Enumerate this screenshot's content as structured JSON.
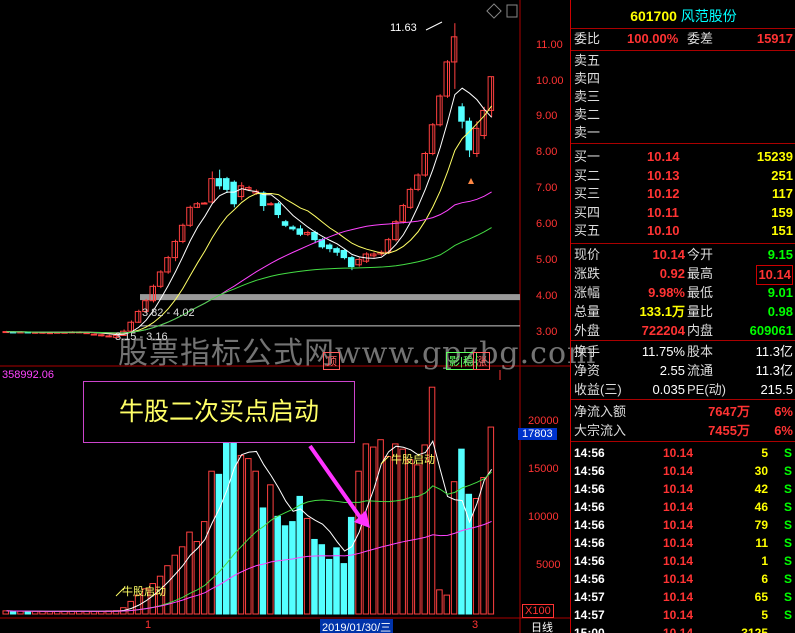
{
  "stock": {
    "code": "601700",
    "name": "风范股份"
  },
  "quote": {
    "wei_bi_label": "委比",
    "wei_bi": "100.00%",
    "wei_cha_label": "委差",
    "wei_cha": "15917",
    "sells": [
      {
        "label": "卖五",
        "price": "",
        "vol": ""
      },
      {
        "label": "卖四",
        "price": "",
        "vol": ""
      },
      {
        "label": "卖三",
        "price": "",
        "vol": ""
      },
      {
        "label": "卖二",
        "price": "",
        "vol": ""
      },
      {
        "label": "卖一",
        "price": "",
        "vol": ""
      }
    ],
    "buys": [
      {
        "label": "买一",
        "price": "10.14",
        "vol": "15239"
      },
      {
        "label": "买二",
        "price": "10.13",
        "vol": "251"
      },
      {
        "label": "买三",
        "price": "10.12",
        "vol": "117"
      },
      {
        "label": "买四",
        "price": "10.11",
        "vol": "159"
      },
      {
        "label": "买五",
        "price": "10.10",
        "vol": "151"
      }
    ],
    "stats": [
      {
        "l1": "现价",
        "v1": "10.14",
        "c1": "red",
        "l2": "今开",
        "v2": "9.15",
        "c2": "grn"
      },
      {
        "l1": "涨跌",
        "v1": "0.92",
        "c1": "red",
        "l2": "最高",
        "v2": "10.14",
        "c2": "red"
      },
      {
        "l1": "涨幅",
        "v1": "9.98%",
        "c1": "red",
        "l2": "最低",
        "v2": "9.01",
        "c2": "grn"
      },
      {
        "l1": "总量",
        "v1": "133.1万",
        "c1": "yel",
        "l2": "量比",
        "v2": "0.98",
        "c2": "grn"
      },
      {
        "l1": "外盘",
        "v1": "722204",
        "c1": "red",
        "l2": "内盘",
        "v2": "609061",
        "c2": "grn"
      }
    ],
    "stats2": [
      {
        "l1": "换手",
        "v1": "11.75%",
        "l2": "股本",
        "v2": "11.3亿"
      },
      {
        "l1": "净资",
        "v1": "2.55",
        "l2": "流通",
        "v2": "11.3亿"
      },
      {
        "l1": "收益(三)",
        "v1": "0.035",
        "l2": "PE(动)",
        "v2": "215.5"
      }
    ],
    "flows": [
      {
        "label": "净流入额",
        "value": "7647万",
        "pct": "6%"
      },
      {
        "label": "大宗流入",
        "value": "7455万",
        "pct": "6%"
      }
    ]
  },
  "ticks": [
    {
      "time": "14:56",
      "price": "10.14",
      "vol": "5",
      "side": "S"
    },
    {
      "time": "14:56",
      "price": "10.14",
      "vol": "30",
      "side": "S"
    },
    {
      "time": "14:56",
      "price": "10.14",
      "vol": "42",
      "side": "S"
    },
    {
      "time": "14:56",
      "price": "10.14",
      "vol": "46",
      "side": "S"
    },
    {
      "time": "14:56",
      "price": "10.14",
      "vol": "79",
      "side": "S"
    },
    {
      "time": "14:56",
      "price": "10.14",
      "vol": "11",
      "side": "S"
    },
    {
      "time": "14:56",
      "price": "10.14",
      "vol": "1",
      "side": "S"
    },
    {
      "time": "14:56",
      "price": "10.14",
      "vol": "6",
      "side": "S"
    },
    {
      "time": "14:57",
      "price": "10.14",
      "vol": "65",
      "side": "S"
    },
    {
      "time": "14:57",
      "price": "10.14",
      "vol": "5",
      "side": "S"
    },
    {
      "time": "15:00",
      "price": "10.14",
      "vol": "3125",
      "side": ""
    }
  ],
  "chart": {
    "price_axis": [
      "11.00",
      "10.00",
      "9.00",
      "8.00",
      "7.00",
      "6.00",
      "5.00",
      "4.00",
      "3.00"
    ],
    "vol_axis": [
      "20000",
      "15000",
      "10000",
      "5000"
    ],
    "peak_label": "11.63",
    "range_label_1": "3.82 - 4.02",
    "range_label_2": "3.15 - 3.16",
    "vol_top_value": "358992.06",
    "vol_cursor_value": "17803",
    "vol_unit": "X100",
    "date_label": "2019/01/30/三",
    "x_tick_1": "1",
    "x_tick_2": "3",
    "bottom_tab": "日线",
    "tag_ding": "顶",
    "tag_ying": "影|稳",
    "tag_zhang": "涨",
    "annotation": "牛股二次买点启动",
    "arrow_label_1": "牛股启动",
    "arrow_label_2": "牛股启动",
    "watermark": "股票指标公式网www.gpzbg.com"
  },
  "colors": {
    "up": "#ff4040",
    "down": "#54ffff",
    "ma1": "#ffffff",
    "ma2": "#ffff66",
    "ma3": "#ff44ff",
    "ma4": "#44dd44"
  }
}
